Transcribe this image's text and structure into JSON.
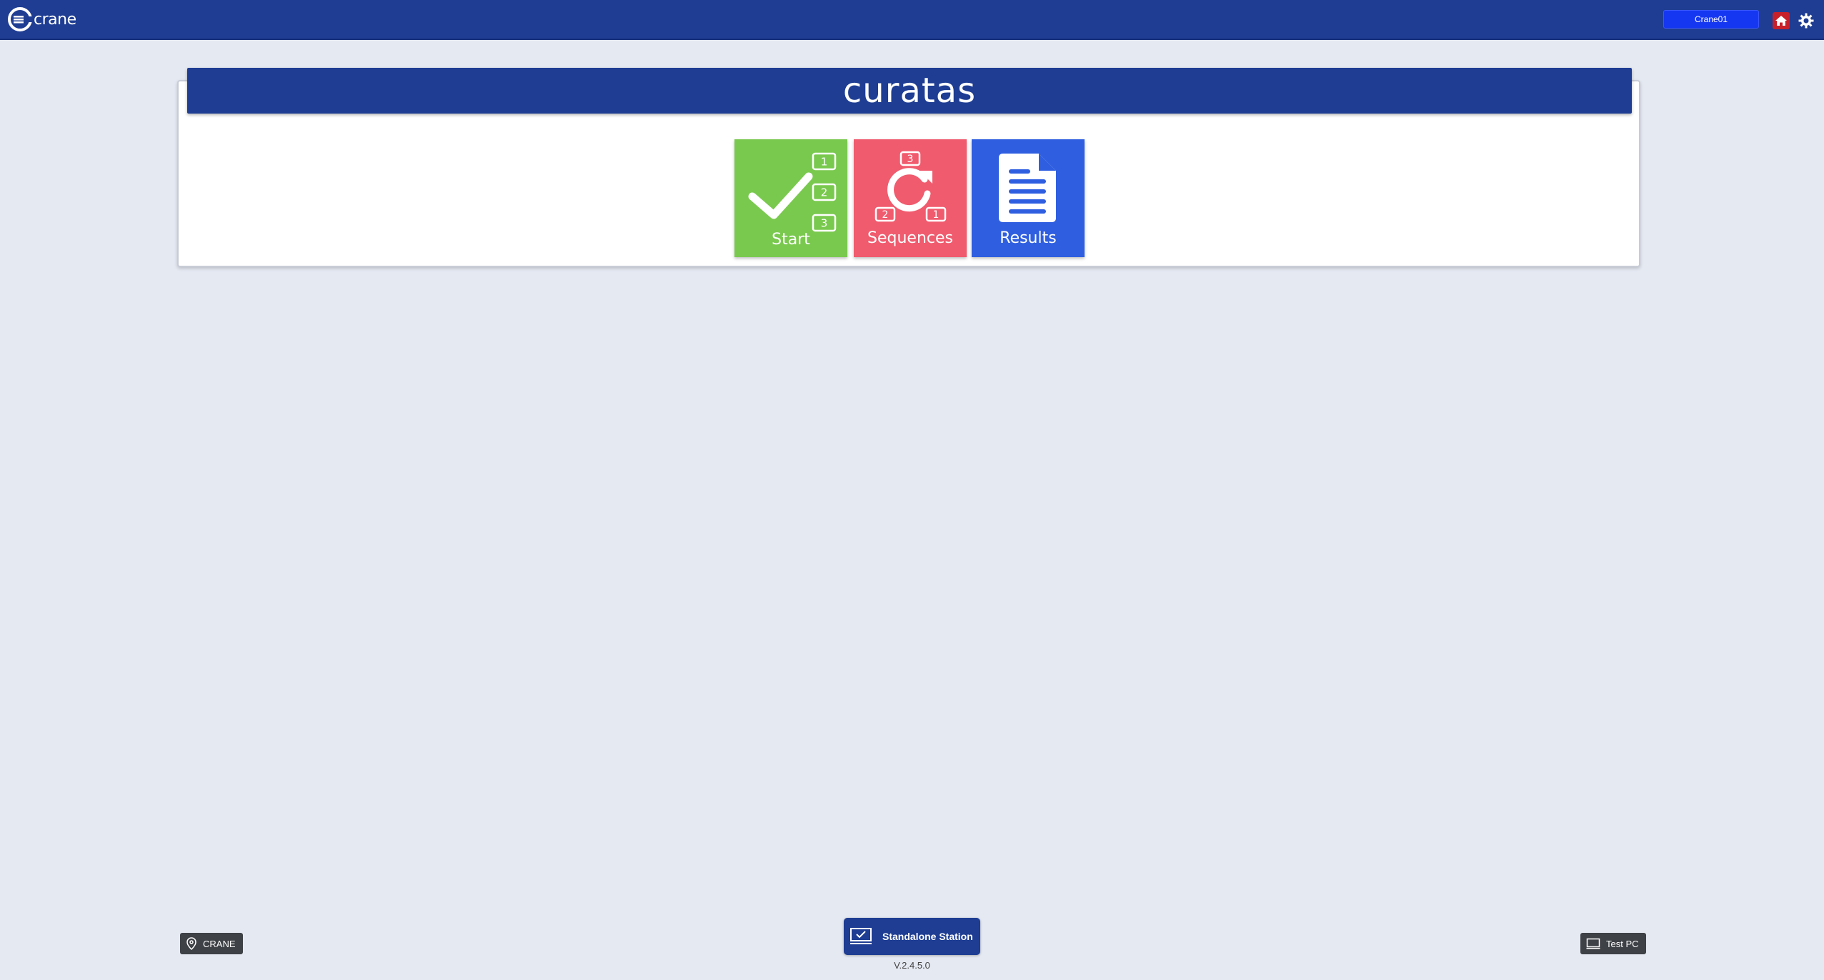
{
  "app": {
    "brand": "crane",
    "user": "Crane01",
    "icons": {
      "home": "home-icon",
      "settings": "gear-icon"
    },
    "colors": {
      "navbar": "#1e3d93",
      "user_box": "#1637f2",
      "home": "#c8202a",
      "background": "#e5e9f2"
    }
  },
  "panel": {
    "title": "curatas",
    "tiles": [
      {
        "label": "Start",
        "icon": "checklist-icon",
        "color": "#7ac94f",
        "badges": [
          "1",
          "2",
          "3"
        ]
      },
      {
        "label": "Sequences",
        "icon": "refresh-sequence-icon",
        "color": "#f05b6e",
        "badges": [
          "3",
          "2",
          "1"
        ]
      },
      {
        "label": "Results",
        "icon": "document-icon",
        "color": "#2f5fe0"
      }
    ]
  },
  "footer": {
    "location": "CRANE",
    "station": "Standalone Station",
    "version": "V.2.4.5.0",
    "pc": "Test PC",
    "icons": {
      "location": "location-pin-icon",
      "station": "monitor-check-icon",
      "pc": "monitor-icon"
    }
  }
}
